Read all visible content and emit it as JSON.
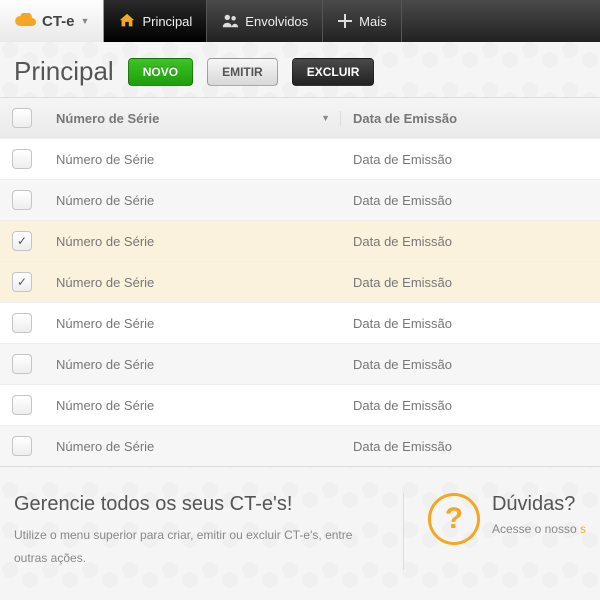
{
  "brand": "CT-e",
  "nav": {
    "principal": "Principal",
    "envolvidos": "Envolvidos",
    "mais": "Mais"
  },
  "page_title": "Principal",
  "buttons": {
    "novo": "NOVO",
    "emitir": "EMITIR",
    "excluir": "EXCLUIR"
  },
  "columns": {
    "serie": "Número de Série",
    "emissao": "Data de Emissão"
  },
  "rows": [
    {
      "serie": "Número de Série",
      "emissao": "Data de Emissão",
      "checked": false,
      "alt": false
    },
    {
      "serie": "Número de Série",
      "emissao": "Data de Emissão",
      "checked": false,
      "alt": true
    },
    {
      "serie": "Número de Série",
      "emissao": "Data de Emissão",
      "checked": true,
      "alt": false,
      "sel": true
    },
    {
      "serie": "Número de Série",
      "emissao": "Data de Emissão",
      "checked": true,
      "alt": true,
      "sel": true
    },
    {
      "serie": "Número de Série",
      "emissao": "Data de Emissão",
      "checked": false,
      "alt": false
    },
    {
      "serie": "Número de Série",
      "emissao": "Data de Emissão",
      "checked": false,
      "alt": true
    },
    {
      "serie": "Número de Série",
      "emissao": "Data de Emissão",
      "checked": false,
      "alt": false
    },
    {
      "serie": "Número de Série",
      "emissao": "Data de Emissão",
      "checked": false,
      "alt": true
    }
  ],
  "info": {
    "left_title": "Gerencie todos os seus CT-e's!",
    "left_body": "Utilize o menu superior para criar, emitir ou excluir CT-e's, entre outras ações.",
    "right_title": "Dúvidas?",
    "right_body_pre": "Acesse o nosso ",
    "right_body_link": "s"
  }
}
